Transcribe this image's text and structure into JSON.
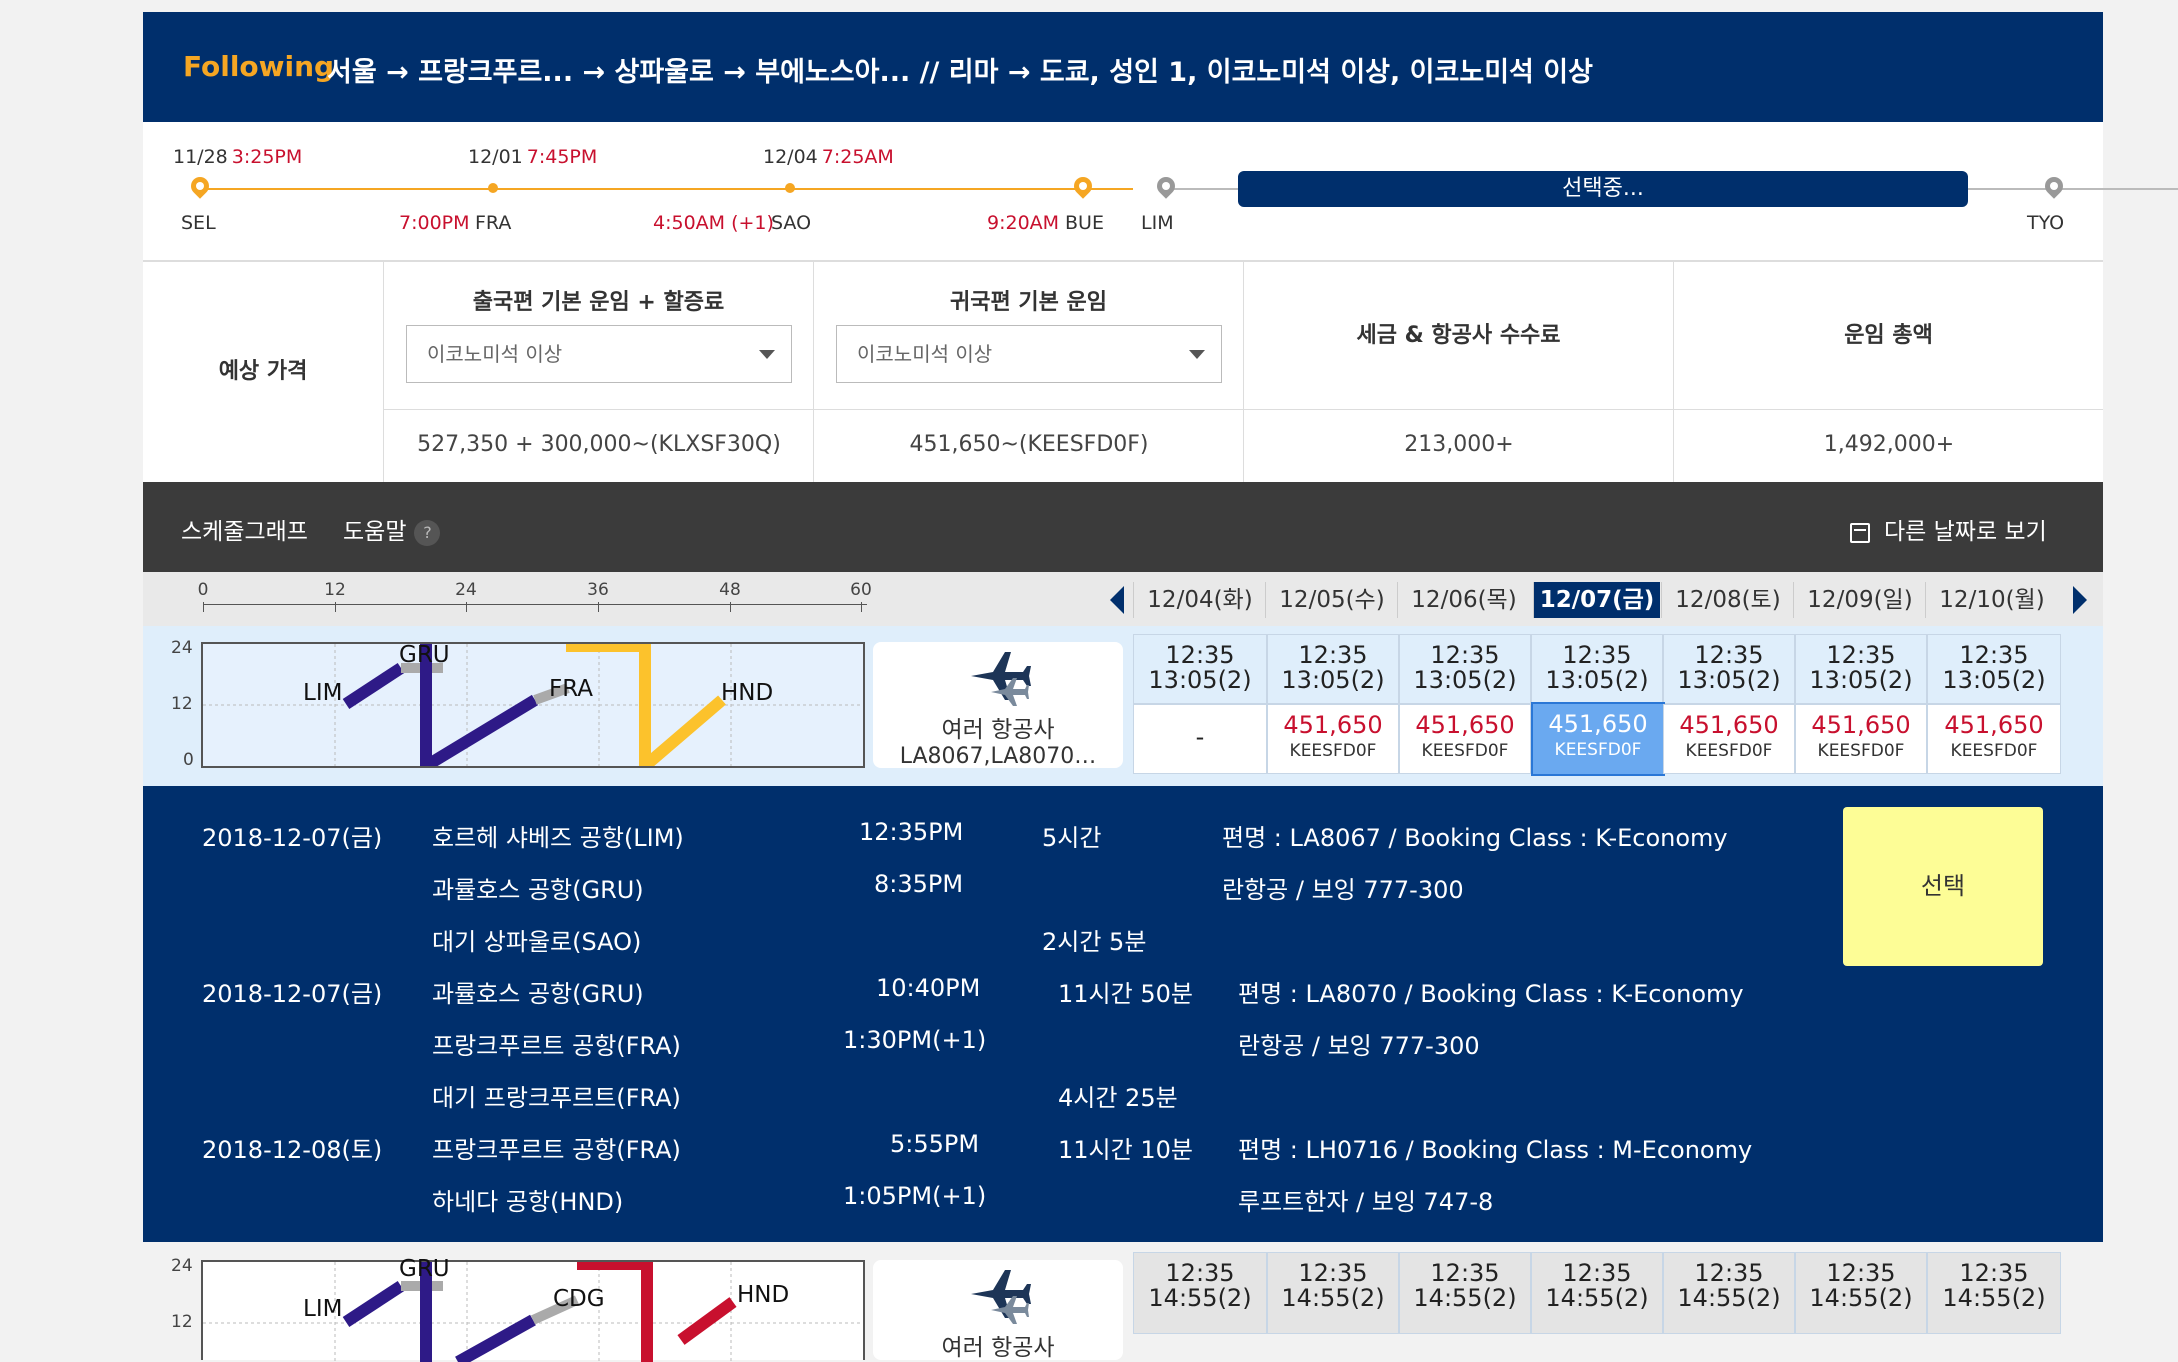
{
  "header": {
    "following": "Following",
    "route": "서울 → 프랑크푸르... → 상파울로 → 부에노스아... // 리마 → 도쿄, 성인 1, 이코노미석 이상, 이코노미석 이상"
  },
  "timeline": {
    "stops": [
      {
        "date": "11/28",
        "time": "3:25PM",
        "code": "SEL",
        "arr": ""
      },
      {
        "date": "12/01",
        "time": "7:45PM",
        "code": "FRA",
        "arr": "7:00PM"
      },
      {
        "date": "12/04",
        "time": "7:25AM",
        "code": "SAO",
        "arr": "4:50AM (+1)"
      },
      {
        "date": "",
        "time": "",
        "code": "BUE",
        "arr": "9:20AM"
      },
      {
        "date": "",
        "time": "",
        "code": "LIM",
        "arr": ""
      },
      {
        "date": "",
        "time": "",
        "code": "TYO",
        "arr": ""
      }
    ],
    "selecting_label": "선택중..."
  },
  "price": {
    "label": "예상 가격",
    "outbound_header": "출국편 기본 운임 + 할증료",
    "inbound_header": "귀국편 기본 운임",
    "tax_header": "세금 & 항공사 수수료",
    "total_header": "운임 총액",
    "outbound_select": "이코노미석 이상",
    "inbound_select": "이코노미석 이상",
    "outbound_value": "527,350 + 300,000~(KLXSF30Q)",
    "inbound_value": "451,650~(KEESFD0F)",
    "tax_value": "213,000+",
    "total_value": "1,492,000+"
  },
  "toolbar": {
    "schedule_graph": "스케줄그래프",
    "help": "도움말",
    "help_icon": "?",
    "other_dates": "다른 날짜로 보기"
  },
  "axis": {
    "ticks": [
      "0",
      "12",
      "24",
      "36",
      "48",
      "60"
    ]
  },
  "dates": [
    "12/04(화)",
    "12/05(수)",
    "12/06(목)",
    "12/07(금)",
    "12/08(토)",
    "12/09(일)",
    "12/10(월)"
  ],
  "flights": [
    {
      "y_labels": [
        "24",
        "12",
        "0"
      ],
      "airports": [
        "LIM",
        "GRU",
        "FRA",
        "HND"
      ],
      "airline": "여러 항공사",
      "flight_numbers": "LA8067,LA8070…",
      "times": [
        "12:35",
        "13:05(2)"
      ],
      "fares": [
        {
          "price": "-",
          "code": ""
        },
        {
          "price": "451,650",
          "code": "KEESFD0F"
        },
        {
          "price": "451,650",
          "code": "KEESFD0F"
        },
        {
          "price": "451,650",
          "code": "KEESFD0F"
        },
        {
          "price": "451,650",
          "code": "KEESFD0F"
        },
        {
          "price": "451,650",
          "code": "KEESFD0F"
        },
        {
          "price": "451,650",
          "code": "KEESFD0F"
        }
      ]
    },
    {
      "y_labels": [
        "24",
        "12"
      ],
      "airports": [
        "LIM",
        "GRU",
        "CDG",
        "HND"
      ],
      "airline": "여러 항공사",
      "times": [
        "12:35",
        "14:55(2)"
      ]
    }
  ],
  "detail": {
    "select_label": "선택",
    "rows": [
      [
        "2018-12-07(금)",
        "호르헤 샤베즈 공항(LIM)",
        "12:35PM",
        "5시간",
        "편명 : LA8067 / Booking Class : K-Economy"
      ],
      [
        "",
        "과률호스 공항(GRU)",
        "8:35PM",
        "",
        "란항공 / 보잉 777-300"
      ],
      [
        "",
        "대기 상파울로(SAO)",
        "",
        "2시간 5분",
        ""
      ],
      [
        "2018-12-07(금)",
        "과률호스 공항(GRU)",
        "10:40PM",
        "11시간 50분",
        "편명 : LA8070 / Booking Class : K-Economy"
      ],
      [
        "",
        "프랑크푸르트 공항(FRA)",
        "1:30PM(+1)",
        "",
        "란항공 / 보잉 777-300"
      ],
      [
        "",
        "대기 프랑크푸르트(FRA)",
        "",
        "4시간 25분",
        ""
      ],
      [
        "2018-12-08(토)",
        "프랑크푸르트 공항(FRA)",
        "5:55PM",
        "11시간 10분",
        "편명 : LH0716 / Booking Class : M-Economy"
      ],
      [
        "",
        "하네다 공항(HND)",
        "1:05PM(+1)",
        "",
        "루프트한자 / 보잉 747-8"
      ]
    ]
  },
  "colors": {
    "navy": "#002f6c",
    "orange": "#f5a623",
    "red": "#c8102e",
    "purple": "#2e1a87",
    "yellow_btn": "#fdfd96"
  }
}
